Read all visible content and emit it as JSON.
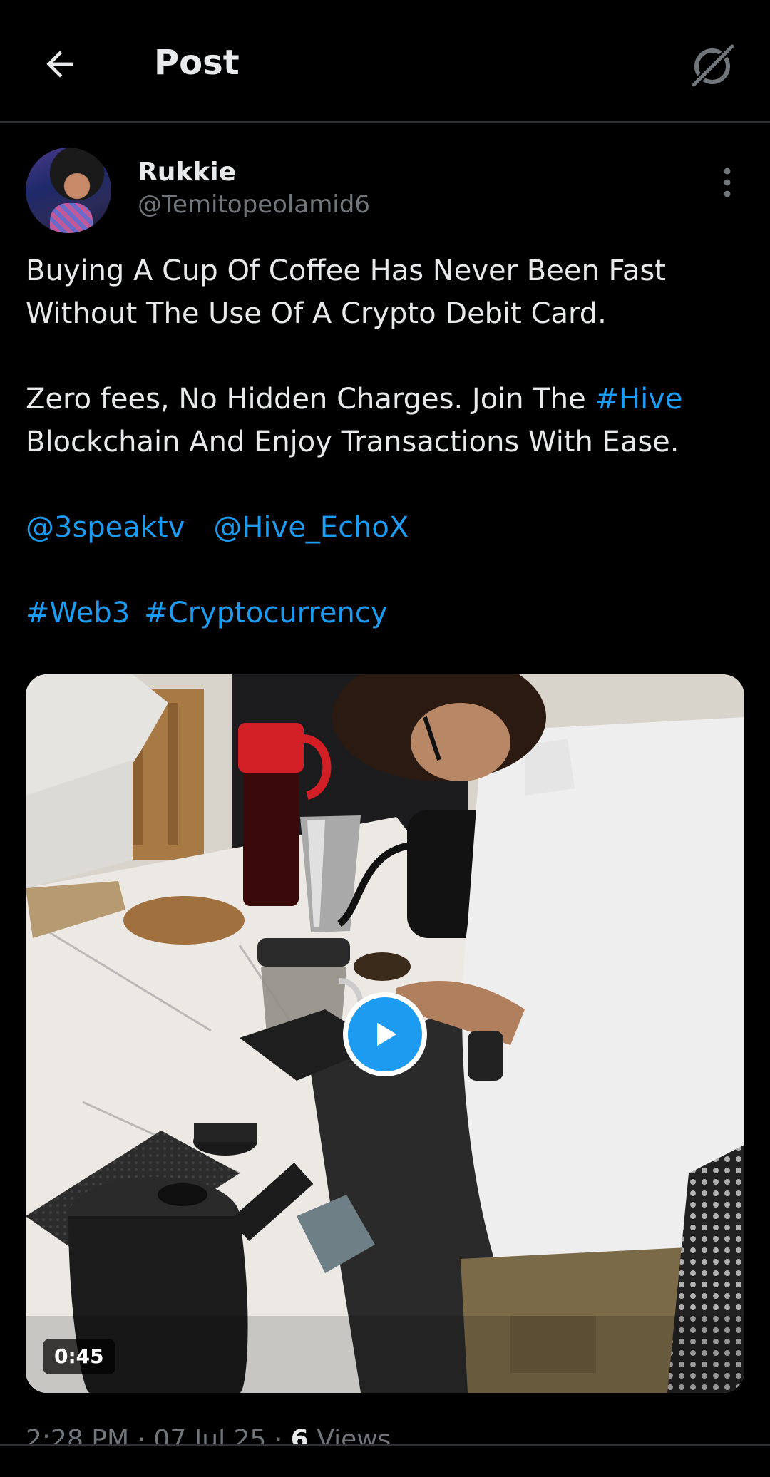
{
  "header": {
    "title": "Post",
    "back_icon": "arrow-left-icon",
    "grok_icon": "grok-icon"
  },
  "post": {
    "author": {
      "name": "Rukkie",
      "handle": "@Temitopeolamid6"
    },
    "more_icon": "more-vertical-icon",
    "paragraphs": {
      "p1_line1": "Buying A Cup Of Coffee Has Never Been Fast",
      "p1_line2": "Without The Use Of A Crypto Debit Card.",
      "p2_prefix": "Zero fees, No Hidden Charges. Join The ",
      "p2_hashtag": "#Hive",
      "p2_line2": "Blockchain And Enjoy Transactions With Ease."
    },
    "mentions": [
      "@3speaktv",
      "@Hive_EchoX"
    ],
    "hashtags": [
      "#Web3",
      "#Cryptocurrency"
    ],
    "video": {
      "duration": "0:45",
      "play_icon": "play-icon"
    },
    "meta": {
      "time": "2:28 PM",
      "separator": "·",
      "date": "07 Jul 25",
      "views_count": "6",
      "views_label": "Views"
    }
  },
  "colors": {
    "background": "#000000",
    "text": "#e7e9ea",
    "secondary_text": "#71767b",
    "accent": "#1d9bf0",
    "divider": "#2f3336"
  }
}
